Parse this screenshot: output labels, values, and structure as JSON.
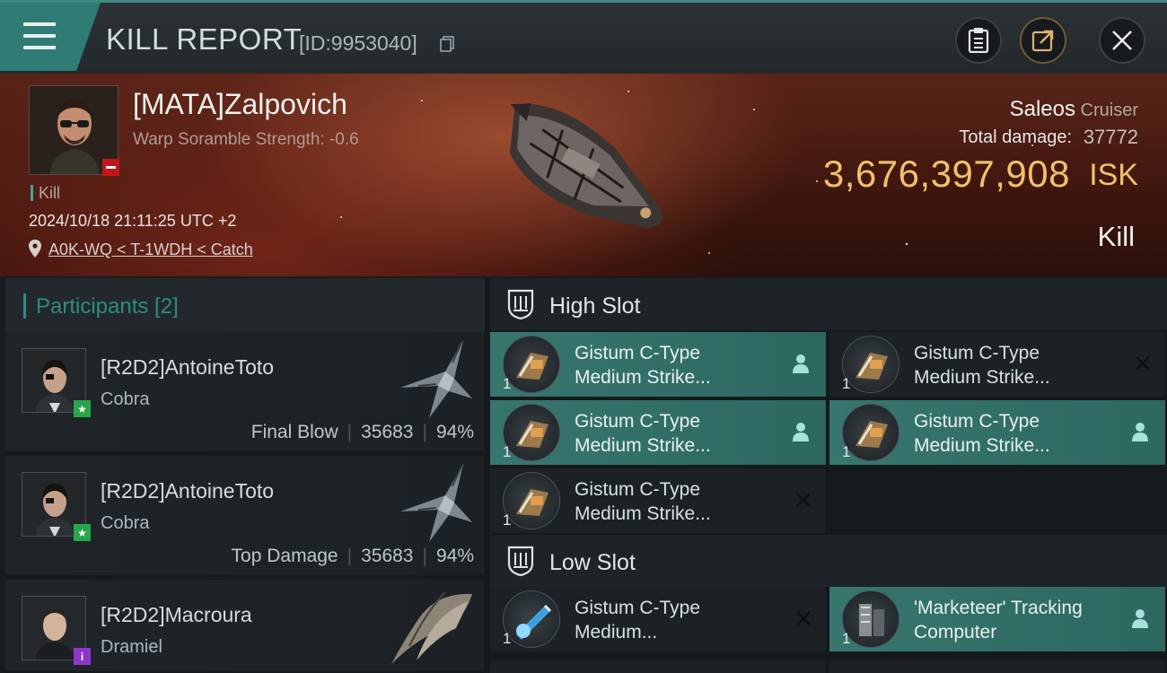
{
  "header": {
    "title": "KILL REPORT",
    "report_id": "[ID:9953040]"
  },
  "victim": {
    "name": "[MATA]Zalpovich",
    "scramble": "Warp Soramble Strength: -0.6",
    "kill_tag": "Kill",
    "datetime": "2024/10/18 21:11:25 UTC +2",
    "location": "A0K-WQ < T-1WDH < Catch",
    "ship_name": "Saleos",
    "ship_class": "Cruiser",
    "damage_label": "Total damage:",
    "damage_value": "37772",
    "isk_value": "3,676,397,908",
    "isk_unit": "ISK",
    "result": "Kill"
  },
  "participants": {
    "label": "Participants [2]",
    "rows": [
      {
        "name": "[R2D2]AntoineToto",
        "ship": "Cobra",
        "role": "Final Blow",
        "damage": "35683",
        "percent": "94%",
        "badge": "star"
      },
      {
        "name": "[R2D2]AntoineToto",
        "ship": "Cobra",
        "role": "Top Damage",
        "damage": "35683",
        "percent": "94%",
        "badge": "star"
      },
      {
        "name": "[R2D2]Macroura",
        "ship": "Dramiel",
        "badge": "info"
      }
    ]
  },
  "slots": {
    "high": {
      "label": "High Slot",
      "modules": [
        {
          "line1": "Gistum C-Type",
          "line2": "Medium Strike...",
          "qty": "1",
          "state": "dropped"
        },
        {
          "line1": "Gistum C-Type",
          "line2": "Medium Strike...",
          "qty": "1",
          "state": "destroyed"
        },
        {
          "line1": "Gistum C-Type",
          "line2": "Medium Strike...",
          "qty": "1",
          "state": "dropped"
        },
        {
          "line1": "Gistum C-Type",
          "line2": "Medium Strike...",
          "qty": "1",
          "state": "dropped"
        },
        {
          "line1": "Gistum C-Type",
          "line2": "Medium Strike...",
          "qty": "1",
          "state": "destroyed"
        }
      ]
    },
    "low": {
      "label": "Low Slot",
      "modules": [
        {
          "line1": "Gistum C-Type",
          "line2": "Medium...",
          "qty": "1",
          "state": "destroyed"
        },
        {
          "line1": "'Marketeer' Tracking",
          "line2": "Computer",
          "qty": "1",
          "state": "dropped"
        }
      ]
    }
  },
  "colors": {
    "accent": "#2f7c74",
    "isk": "#f2c06a",
    "highlight_row": "#37766f"
  },
  "icons": {
    "menu": "hamburger-menu-icon",
    "copy": "copy-icon",
    "clipboard": "clipboard-icon",
    "share": "share-icon",
    "close": "close-icon",
    "location": "location-pin-icon",
    "slot": "shield-slot-icon",
    "dropped": "pilot-person-icon",
    "destroyed": "x-destroyed-icon"
  }
}
